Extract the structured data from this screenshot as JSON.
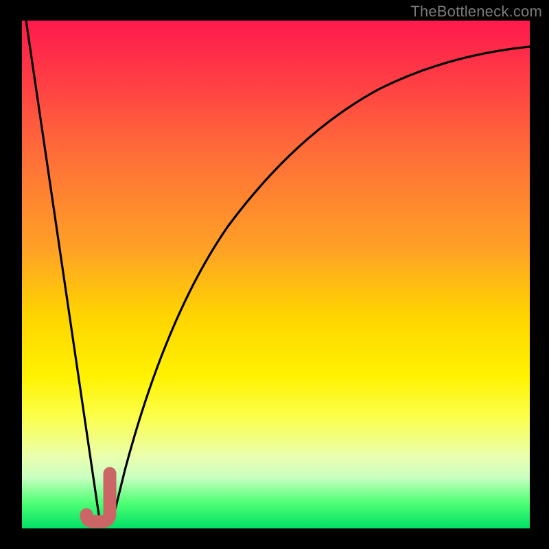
{
  "watermark": "TheBottleneck.com",
  "colors": {
    "frame": "#000000",
    "curve": "#000000",
    "marker": "#cc6666",
    "gradient_top": "#ff1a4d",
    "gradient_bottom": "#00e066"
  },
  "chart_data": {
    "type": "line",
    "title": "",
    "xlabel": "",
    "ylabel": "",
    "xlim": [
      0,
      100
    ],
    "ylim": [
      0,
      100
    ],
    "grid": false,
    "legend": false,
    "series": [
      {
        "name": "bottleneck-curve",
        "x": [
          0,
          2,
          4,
          6,
          8,
          10,
          12,
          14,
          15.5,
          17,
          19,
          22,
          25,
          28,
          32,
          36,
          40,
          45,
          50,
          55,
          60,
          65,
          70,
          75,
          80,
          85,
          90,
          95,
          100
        ],
        "y": [
          100,
          88,
          75,
          63,
          50,
          38,
          25,
          12,
          2,
          2,
          10,
          24,
          36,
          46,
          56,
          64,
          70,
          76,
          80.5,
          83.8,
          86.2,
          88.2,
          89.8,
          91.0,
          92.1,
          93.0,
          93.7,
          94.3,
          94.8
        ]
      }
    ],
    "marker": {
      "name": "optimal-point",
      "x_range": [
        14,
        17.3
      ],
      "y_range": [
        1.3,
        10
      ],
      "shape": "J"
    }
  }
}
